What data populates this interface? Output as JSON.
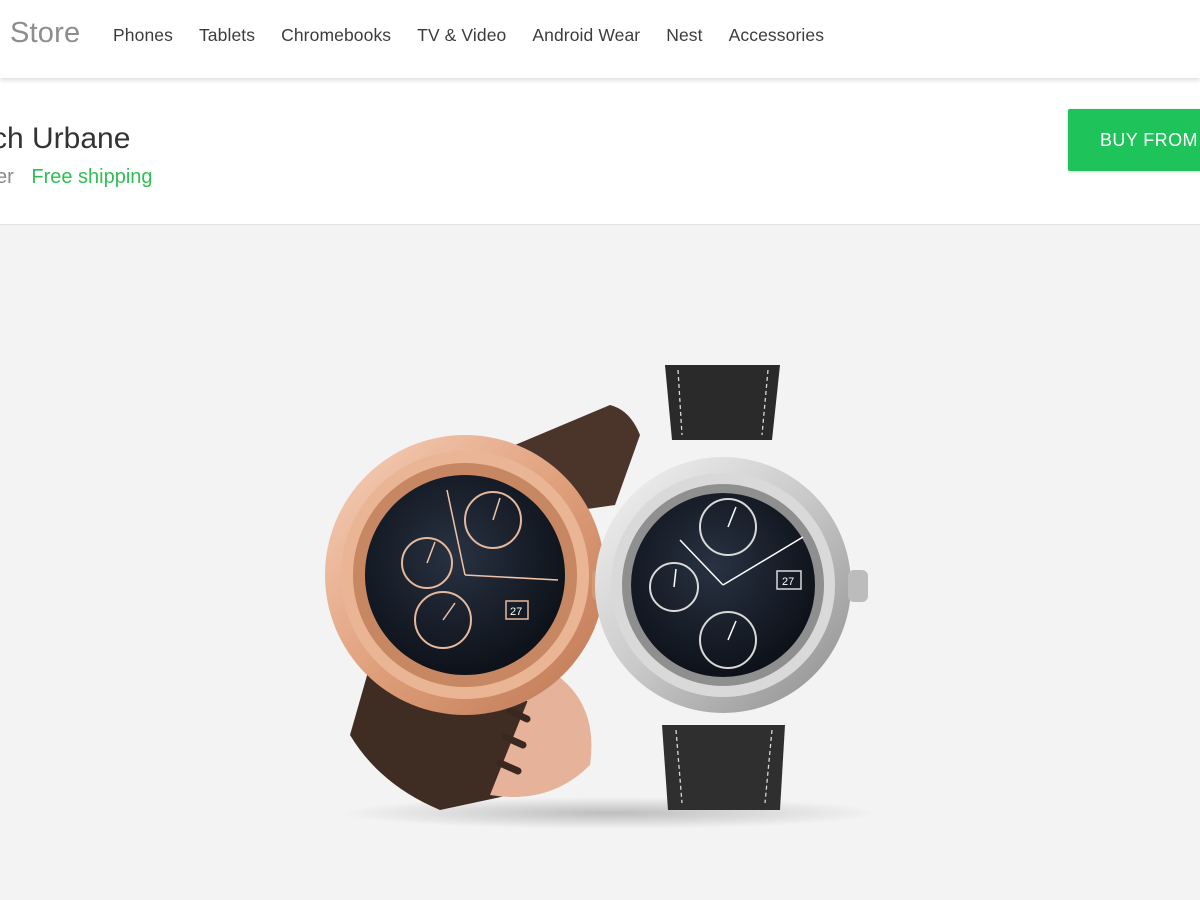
{
  "header": {
    "brand": "Store",
    "nav": [
      "Phones",
      "Tablets",
      "Chromebooks",
      "TV & Video",
      "Android Wear",
      "Nest",
      "Accessories"
    ]
  },
  "product": {
    "title": "ch Urbane",
    "seller": "er",
    "shipping": "Free shipping",
    "buy_label": "BUY FROM",
    "watch_date": "27"
  },
  "hero": {
    "image": "watch-pair-image"
  },
  "colors": {
    "accent_green": "#1ec45a",
    "shipping_green": "#2fbf55",
    "hero_background": "#f3f3f3"
  }
}
